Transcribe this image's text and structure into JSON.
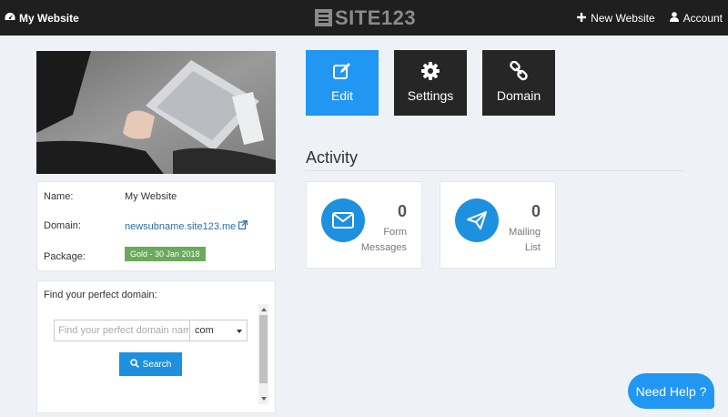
{
  "topbar": {
    "site_label": "My Website",
    "logo_text": "SITE123",
    "new_website_label": "New Website",
    "account_label": "Account"
  },
  "actions": {
    "edit_label": "Edit",
    "settings_label": "Settings",
    "domain_label": "Domain"
  },
  "info": {
    "name_label": "Name:",
    "name_value": "My Website",
    "domain_label": "Domain:",
    "domain_value": "newsubname.site123.me",
    "package_label": "Package:",
    "package_value": "Gold - 30 Jan 2018"
  },
  "domain_search": {
    "title": "Find your perfect domain:",
    "placeholder": "Find your perfect domain name",
    "tld_selected": "com",
    "search_label": "Search"
  },
  "activity": {
    "title": "Activity",
    "form_messages": {
      "count": "0",
      "label_line1": "Form",
      "label_line2": "Messages"
    },
    "mailing_list": {
      "count": "0",
      "label_line1": "Mailing",
      "label_line2": "List"
    }
  },
  "help_label": "Need Help ?",
  "colors": {
    "accent": "#2196f3",
    "topbar": "#1f1f1f",
    "dark_button": "#262626",
    "badge": "#6aaa5a",
    "background": "#eef2f6"
  },
  "icons": [
    "dashboard-icon",
    "plus-icon",
    "user-icon",
    "edit-icon",
    "gear-icon",
    "link-icon",
    "external-link-icon",
    "search-icon",
    "envelope-icon",
    "paper-plane-icon"
  ]
}
